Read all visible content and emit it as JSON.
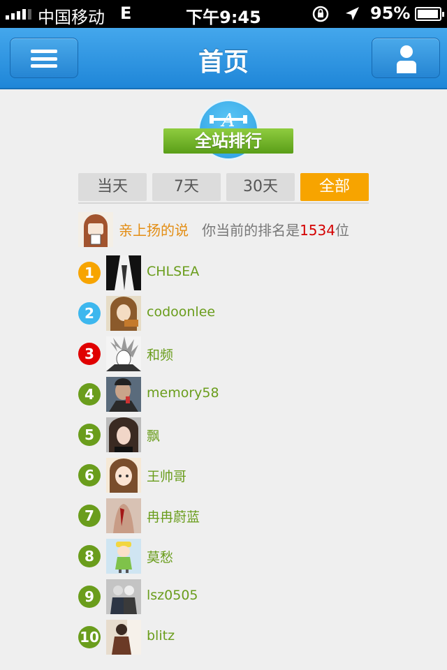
{
  "status_bar": {
    "carrier": "中国移动",
    "network": "E",
    "time": "下午9:45",
    "battery": "95%",
    "battery_level": 0.95
  },
  "nav": {
    "title": "首页",
    "left_icon": "menu-icon",
    "right_icon": "user-icon"
  },
  "badge": {
    "emblem": "A",
    "label": "全站排行"
  },
  "tabs": [
    {
      "label": "当天",
      "active": false
    },
    {
      "label": "7天",
      "active": false
    },
    {
      "label": "30天",
      "active": false
    },
    {
      "label": "全部",
      "active": true
    }
  ],
  "me": {
    "username": "亲上扬的说",
    "prefix": "你当前的排名是",
    "rank": "1534",
    "suffix": "位"
  },
  "ranking": [
    {
      "rank": "1",
      "name": "CHLSEA",
      "badge_color": "#f7a400"
    },
    {
      "rank": "2",
      "name": "codoonlee",
      "badge_color": "#3db7ee"
    },
    {
      "rank": "3",
      "name": "和频",
      "badge_color": "#e00000"
    },
    {
      "rank": "4",
      "name": "memory58",
      "badge_color": "#6a9d1c"
    },
    {
      "rank": "5",
      "name": "飘",
      "badge_color": "#6a9d1c"
    },
    {
      "rank": "6",
      "name": "王帅哥",
      "badge_color": "#6a9d1c"
    },
    {
      "rank": "7",
      "name": "冉冉蔚蓝",
      "badge_color": "#6a9d1c"
    },
    {
      "rank": "8",
      "name": "莫愁",
      "badge_color": "#6a9d1c"
    },
    {
      "rank": "9",
      "name": "lsz0505",
      "badge_color": "#6a9d1c"
    },
    {
      "rank": "10",
      "name": "blitz",
      "badge_color": "#6a9d1c"
    }
  ],
  "colors": {
    "nav_blue": "#2b8fde",
    "accent_orange": "#f7a400",
    "name_green": "#6a9d1c",
    "rank_red": "#d40000"
  }
}
